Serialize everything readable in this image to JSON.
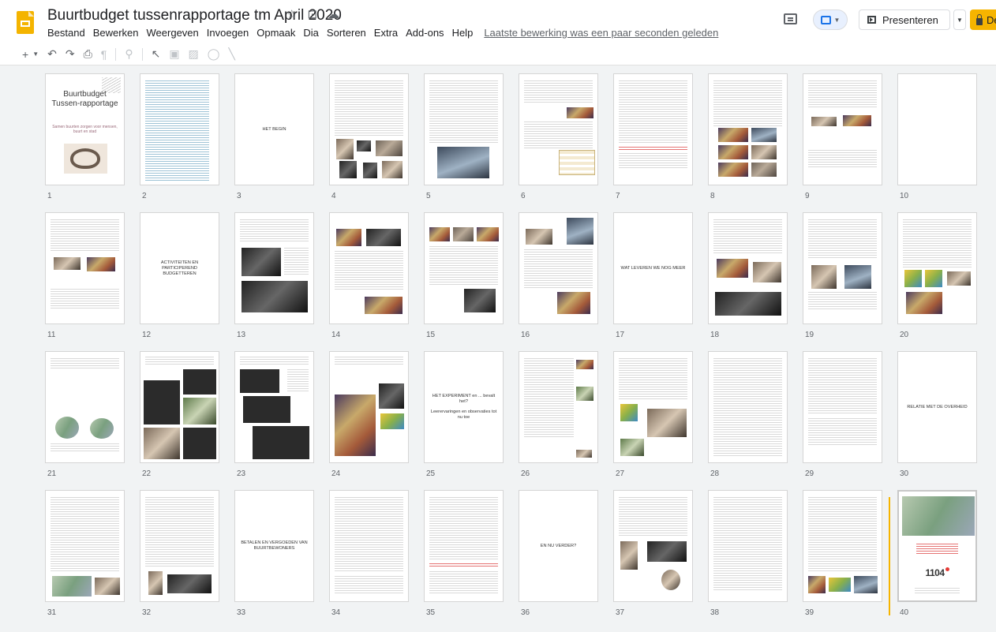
{
  "header": {
    "title": "Buurtbudget tussenrapportage tm April 2020",
    "title_icons": [
      "star-icon",
      "move-to-folder-icon",
      "cloud-status-icon"
    ],
    "menu": [
      "Bestand",
      "Bewerken",
      "Weergeven",
      "Invoegen",
      "Opmaak",
      "Dia",
      "Sorteren",
      "Extra",
      "Add-ons",
      "Help"
    ],
    "last_edit": "Laatste bewerking was een paar seconden geleden",
    "present_label": "Presenteren",
    "share_label": "Delen"
  },
  "toolbar": {
    "icons": [
      "plus-icon",
      "caret-icon",
      "undo-icon",
      "redo-icon",
      "print-icon",
      "paint-format-icon",
      "zoom-icon",
      "select-icon",
      "text-box-icon",
      "image-icon",
      "shape-icon",
      "line-icon"
    ]
  },
  "accent": "#f6b400",
  "slides": [
    {
      "n": "1",
      "cover_title": "Buurtbudget Tussen-rapportage",
      "cover_sub": "Samen buurten zorgen voor mensen, buurt en stad"
    },
    {
      "n": "2"
    },
    {
      "n": "3",
      "text": "HET BEGIN"
    },
    {
      "n": "4"
    },
    {
      "n": "5"
    },
    {
      "n": "6"
    },
    {
      "n": "7"
    },
    {
      "n": "8"
    },
    {
      "n": "9"
    },
    {
      "n": "10"
    },
    {
      "n": "11"
    },
    {
      "n": "12",
      "text": "ACTIVITEITEN EN PARTICIPEREND BUDGETTEREN"
    },
    {
      "n": "13"
    },
    {
      "n": "14"
    },
    {
      "n": "15"
    },
    {
      "n": "16"
    },
    {
      "n": "17",
      "text": "WAT LEVEREN WE NOG MEER"
    },
    {
      "n": "18"
    },
    {
      "n": "19"
    },
    {
      "n": "20"
    },
    {
      "n": "21"
    },
    {
      "n": "22"
    },
    {
      "n": "23"
    },
    {
      "n": "24"
    },
    {
      "n": "25",
      "text": "HET EXPERIMENT en ... bevalt het?",
      "text2": "Leerervaringen en observaties tot nu toe"
    },
    {
      "n": "26"
    },
    {
      "n": "27"
    },
    {
      "n": "28"
    },
    {
      "n": "29"
    },
    {
      "n": "30",
      "text": "RELATIE MET DE OVERHEID"
    },
    {
      "n": "31"
    },
    {
      "n": "32"
    },
    {
      "n": "33",
      "text": "BETALEN EN VERGOEDEN VAN BUURTBEWONERS"
    },
    {
      "n": "34"
    },
    {
      "n": "35"
    },
    {
      "n": "36",
      "text": "EN NU VERDER?"
    },
    {
      "n": "37"
    },
    {
      "n": "38"
    },
    {
      "n": "39"
    },
    {
      "n": "40",
      "logo_text": "1104"
    }
  ]
}
